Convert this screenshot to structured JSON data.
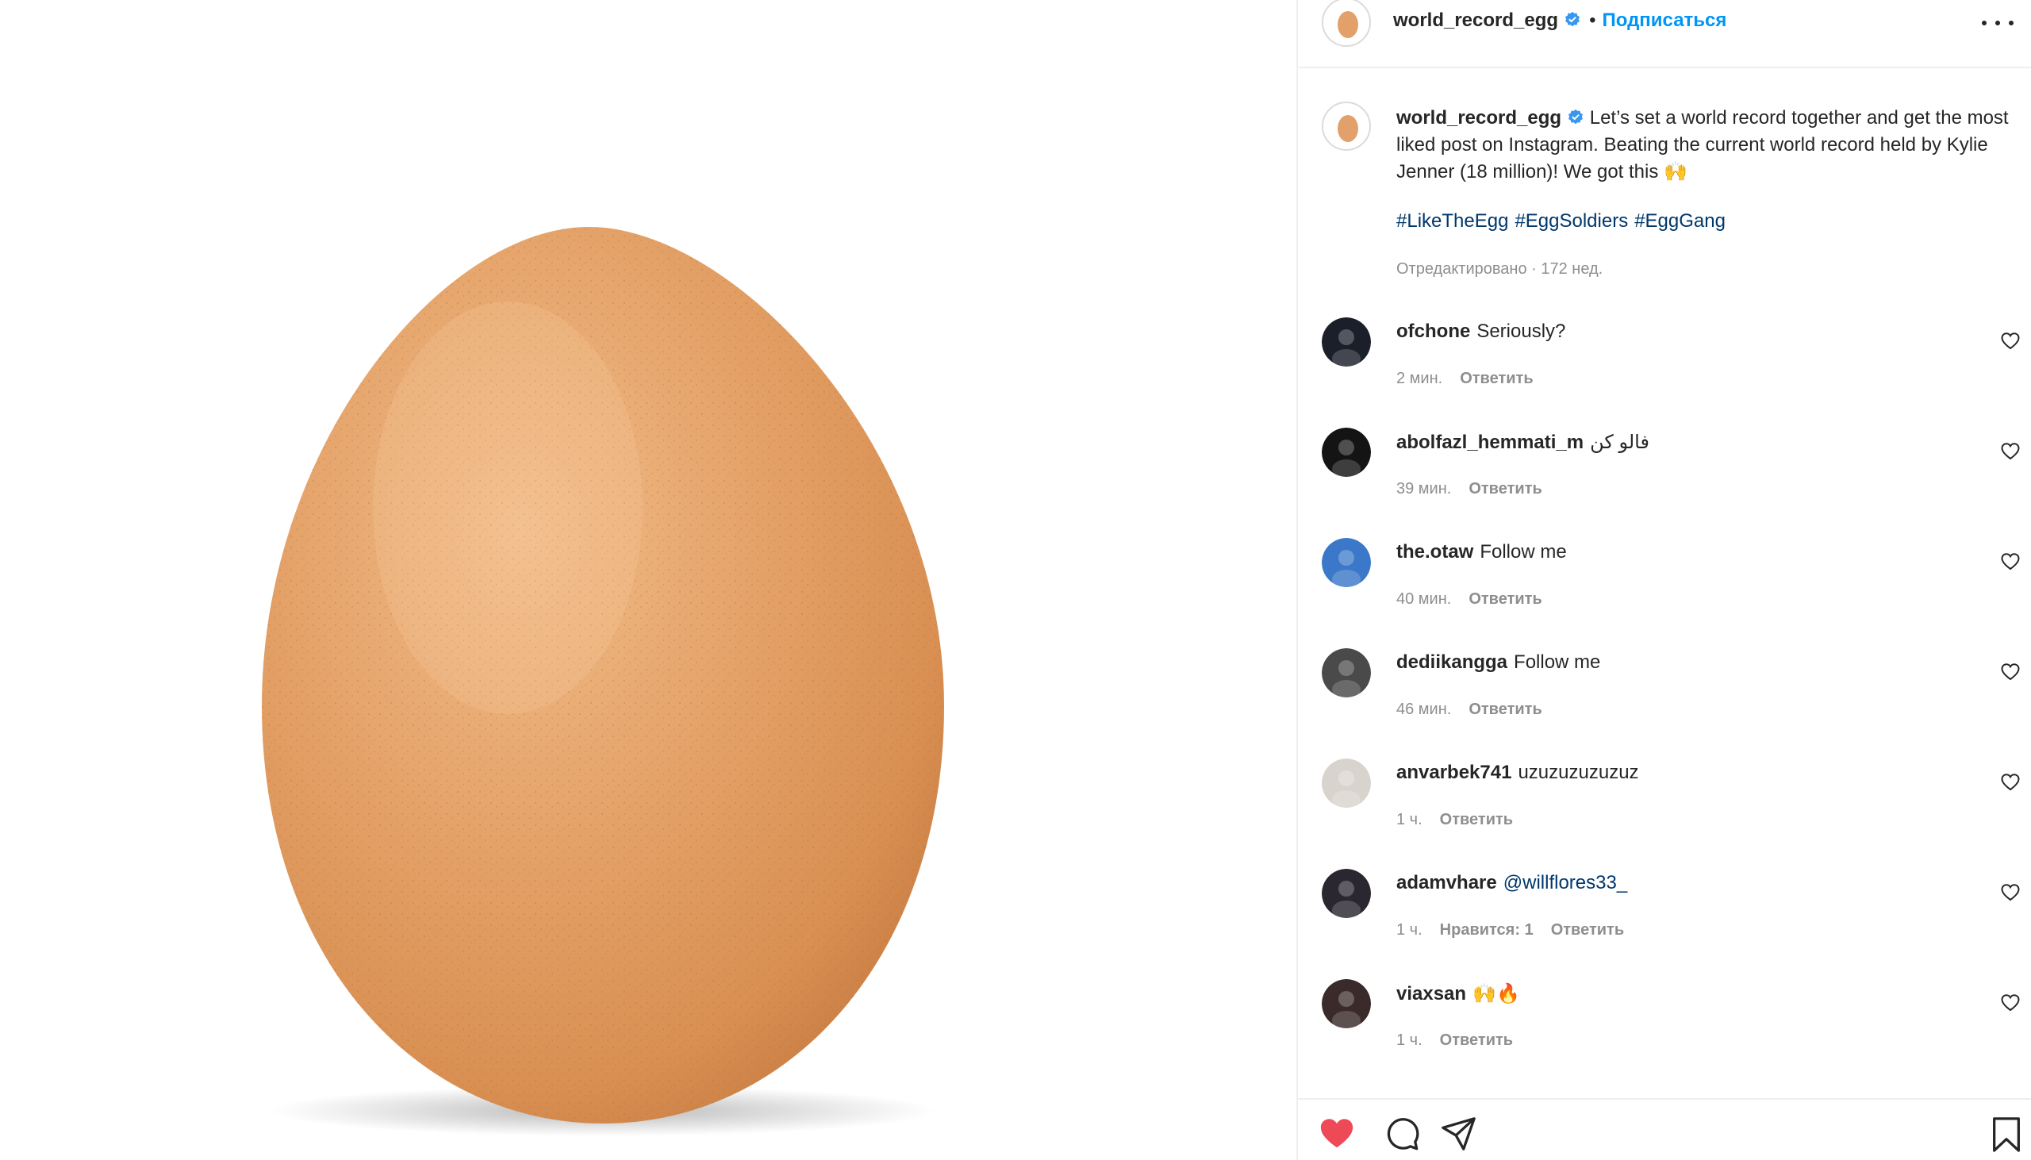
{
  "post": {
    "username": "world_record_egg",
    "separator": "•",
    "follow_label": "Подписаться",
    "caption": "Let’s set a world record together and get the most liked post on Instagram. Beating the current world record held by Kylie Jenner (18 million)! We got this 🙌",
    "hashtags": [
      "#LikeTheEgg",
      "#EggSoldiers",
      "#EggGang"
    ],
    "edited_label": "Отредактировано",
    "edited_sep": "·",
    "edited_time": "172 нед."
  },
  "reply_label": "Ответить",
  "comments": [
    {
      "user": "ofchone",
      "text": "Seriously?",
      "time": "2 мин.",
      "avatar_color": "#1b1f2a"
    },
    {
      "user": "abolfazl_hemmati_m",
      "text": "فالو کن",
      "time": "39 мин.",
      "avatar_color": "#141414"
    },
    {
      "user": "the.otaw",
      "text": "Follow me",
      "time": "40 мин.",
      "avatar_color": "#3b78c9"
    },
    {
      "user": "dediikangga",
      "text": "Follow me",
      "time": "46 мин.",
      "avatar_color": "#4a4a4a"
    },
    {
      "user": "anvarbek741",
      "text": "uzuzuzuzuzuz",
      "time": "1 ч.",
      "avatar_color": "#d8d3cc"
    },
    {
      "user": "adamvhare",
      "text": "@willflores33_",
      "time": "1 ч.",
      "likes": "Нравится: 1",
      "avatar_color": "#2a2730"
    },
    {
      "user": "viaxsan",
      "text": "🙌🔥",
      "time": "1 ч.",
      "avatar_color": "#3a2a2a"
    }
  ],
  "colors": {
    "accent": "#0095f6",
    "hashtag": "#00376b",
    "liked_heart": "#ed4956",
    "muted_text": "#8e8e8e",
    "egg": "#e2a06a"
  },
  "icons": {
    "like": "heart-filled-icon",
    "comment": "speech-bubble-icon",
    "share": "paper-plane-icon",
    "save": "bookmark-icon",
    "more": "ellipsis-icon",
    "verified": "verified-badge-icon"
  }
}
